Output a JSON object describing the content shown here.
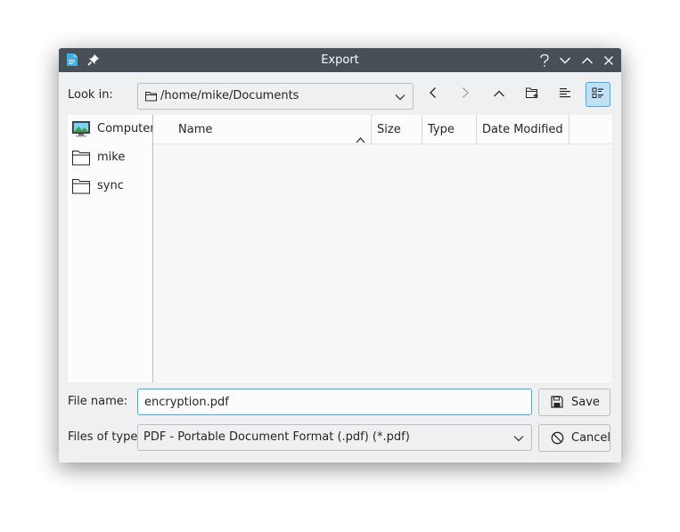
{
  "window": {
    "title": "Export"
  },
  "toolbar": {
    "look_in_label": "Look in:",
    "path": "/home/mike/Documents",
    "icons": [
      "chevron-left-icon",
      "chevron-right-icon",
      "parent-dir-icon",
      "new-folder-icon",
      "list-view-icon",
      "detail-view-icon"
    ]
  },
  "places": [
    {
      "label": "Computer",
      "icon": "computer-icon"
    },
    {
      "label": "mike",
      "icon": "folder-icon"
    },
    {
      "label": "sync",
      "icon": "folder-icon"
    }
  ],
  "filelist": {
    "columns": [
      "Name",
      "Size",
      "Type",
      "Date Modified"
    ],
    "rows": []
  },
  "form": {
    "filename_label": "File name:",
    "filename_value": "encryption.pdf",
    "filetype_label": "Files of type:",
    "filetype_value": "PDF - Portable Document Format (.pdf) (*.pdf)"
  },
  "buttons": {
    "save": "Save",
    "cancel": "Cancel"
  },
  "colors": {
    "titlebar": "#475057",
    "accent": "#3daee9",
    "window": "#eff0f1"
  }
}
